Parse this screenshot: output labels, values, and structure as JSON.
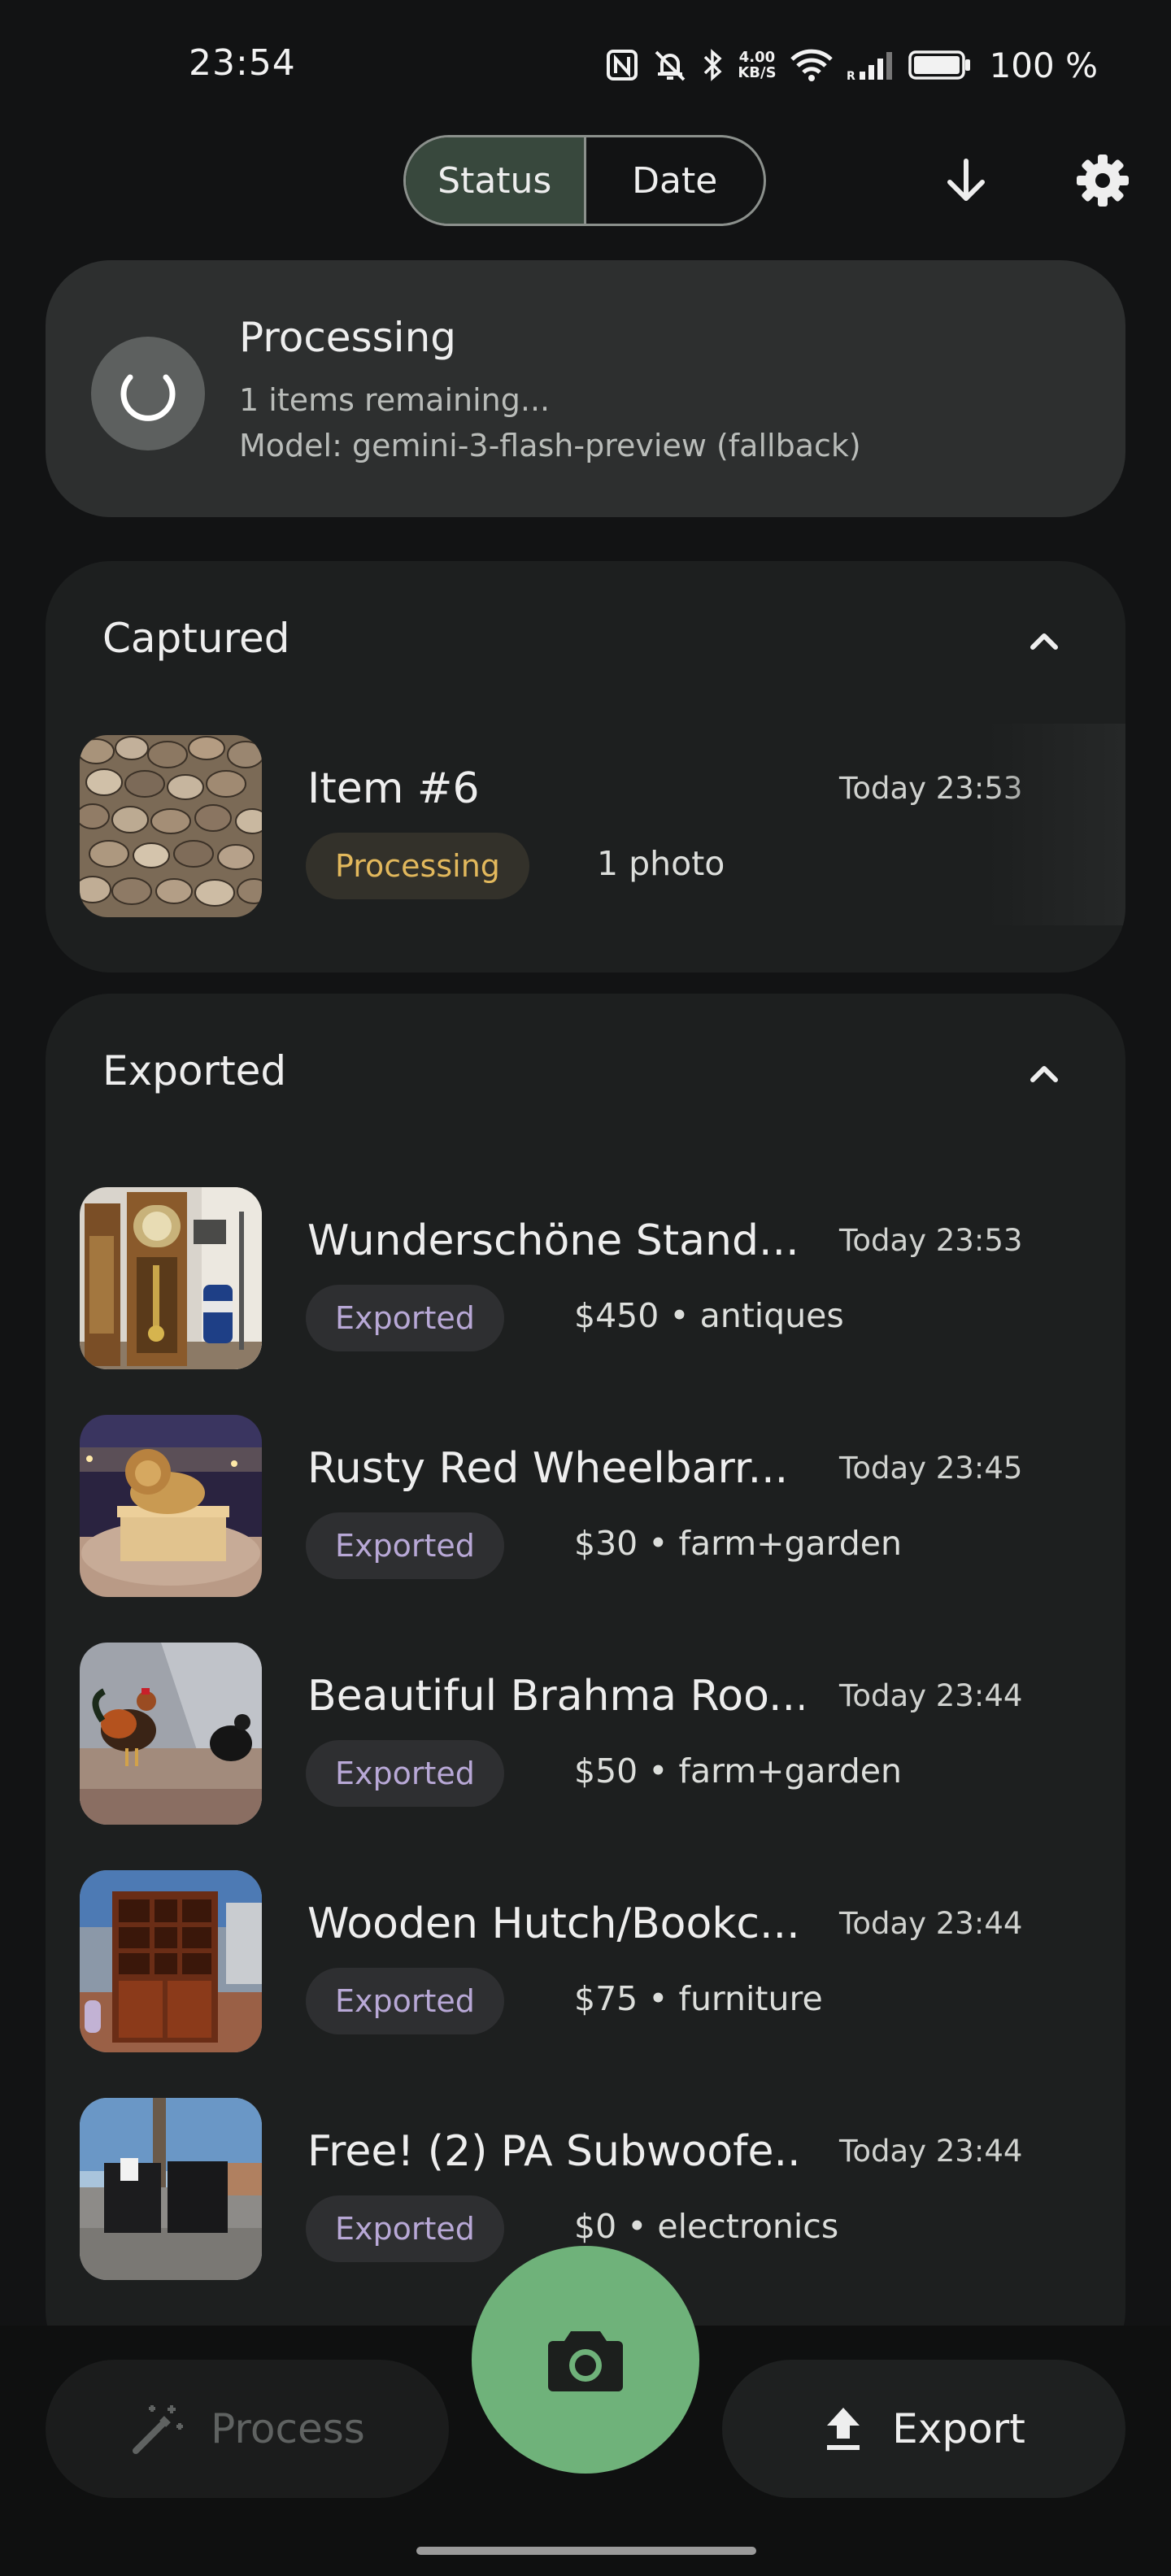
{
  "status_bar": {
    "time": "23:54",
    "net_speed_value": "4.00",
    "net_speed_unit": "KB/S",
    "battery": "100 %"
  },
  "header": {
    "tabs": [
      {
        "label": "Status",
        "active": true
      },
      {
        "label": "Date",
        "active": false
      }
    ],
    "download_icon": "arrow-down-icon",
    "settings_icon": "gear-icon"
  },
  "processing": {
    "title": "Processing",
    "remaining": "1 items remaining...",
    "model": "Model: gemini-3-flash-preview (fallback)"
  },
  "sections": [
    {
      "title": "Captured",
      "expanded": true,
      "items": [
        {
          "title": "Item #6",
          "time": "Today 23:53",
          "status": "Processing",
          "meta": "1 photo",
          "thumb": "pebbles"
        }
      ]
    },
    {
      "title": "Exported",
      "expanded": true,
      "items": [
        {
          "title": "Wunderschöne Stand...",
          "time": "Today 23:53",
          "status": "Exported",
          "meta": "$450 • antiques",
          "thumb": "grandfather-clock"
        },
        {
          "title": "Rusty Red Wheelbarr...",
          "time": "Today 23:45",
          "status": "Exported",
          "meta": "$30 • farm+garden",
          "thumb": "lion-statue"
        },
        {
          "title": "Beautiful Brahma Roo...",
          "time": "Today 23:44",
          "status": "Exported",
          "meta": "$50 • farm+garden",
          "thumb": "roosters"
        },
        {
          "title": "Wooden Hutch/Bookc...",
          "time": "Today 23:44",
          "status": "Exported",
          "meta": "$75 • furniture",
          "thumb": "wooden-hutch"
        },
        {
          "title": "Free! (2) PA Subwoofe...",
          "time": "Today 23:44",
          "status": "Exported",
          "meta": "$0 • electronics",
          "thumb": "subwoofers"
        }
      ]
    }
  ],
  "bottom_bar": {
    "process_label": "Process",
    "export_label": "Export",
    "camera_icon": "camera-icon"
  },
  "colors": {
    "background": "#121314",
    "accent_green": "#6fb27a",
    "processing_chip_text": "#e2b85c",
    "exported_chip_text": "#b8a8d6"
  }
}
